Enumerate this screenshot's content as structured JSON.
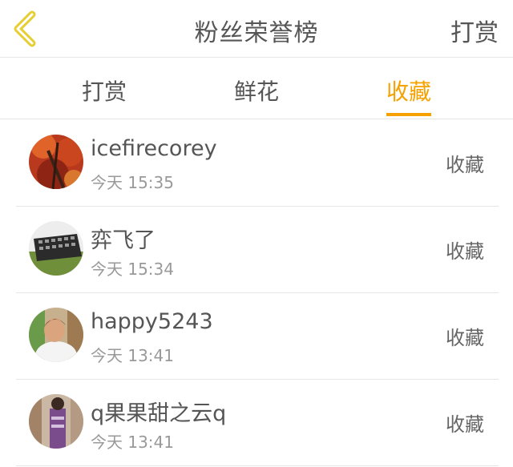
{
  "header": {
    "title": "粉丝荣誉榜",
    "right_action": "打赏",
    "back_icon": "chevron-left-icon",
    "accent_color": "#f5a200"
  },
  "tabs": [
    {
      "label": "打赏",
      "active": false
    },
    {
      "label": "鲜花",
      "active": false
    },
    {
      "label": "收藏",
      "active": true
    }
  ],
  "list": [
    {
      "name": "icefirecorey",
      "time": "今天 15:35",
      "status": "收藏",
      "avatar": "red-autumn-tree-photo"
    },
    {
      "name": "弈飞了",
      "time": "今天 15:34",
      "status": "收藏",
      "avatar": "keyboard-photo"
    },
    {
      "name": "happy5243",
      "time": "今天 13:41",
      "status": "收藏",
      "avatar": "man-portrait-photo"
    },
    {
      "name": "q果果甜之云q",
      "time": "今天 13:41",
      "status": "收藏",
      "avatar": "woman-photo"
    }
  ]
}
